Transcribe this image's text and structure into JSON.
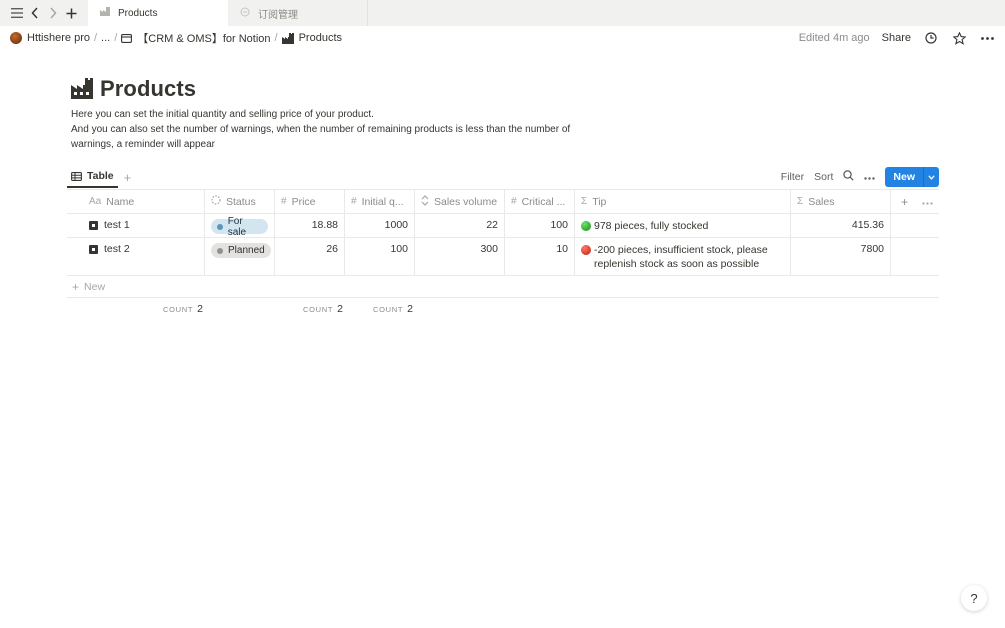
{
  "tabs": [
    {
      "label": "Products",
      "active": true
    },
    {
      "label": "订阅管理",
      "active": false
    }
  ],
  "breadcrumb": {
    "workspace": "Httishere pro",
    "ellipsis": "...",
    "parent": "【CRM & OMS】for Notion",
    "current": "Products",
    "separator": "/"
  },
  "header": {
    "edited": "Edited 4m ago",
    "share": "Share"
  },
  "page": {
    "title": "Products",
    "description": [
      "Here you can set the initial quantity and selling price of your product.",
      "And you can also set the number of warnings, when the number of remaining products is less than the number of warnings, a reminder will appear"
    ]
  },
  "view": {
    "tab_label": "Table",
    "filter": "Filter",
    "sort": "Sort",
    "new_label": "New"
  },
  "table": {
    "columns": [
      {
        "icon": "Aa",
        "label": "Name"
      },
      {
        "icon": "status-icon",
        "label": "Status"
      },
      {
        "icon": "#",
        "label": "Price"
      },
      {
        "icon": "#",
        "label": "Initial q..."
      },
      {
        "icon": "rollup-icon",
        "label": "Sales volume"
      },
      {
        "icon": "#",
        "label": "Critical ..."
      },
      {
        "icon": "Σ",
        "label": "Tip"
      },
      {
        "icon": "Σ",
        "label": "Sales"
      }
    ],
    "rows": [
      {
        "name": "test 1",
        "status": "For sale",
        "status_color": "#d3e5ef",
        "price": "18.88",
        "initial": "1000",
        "sales_volume": "22",
        "critical": "100",
        "tip_indicator": "green",
        "tip": "978 pieces, fully stocked",
        "sales": "415.36"
      },
      {
        "name": "test 2",
        "status": "Planned",
        "status_color": "#e3e2e0",
        "price": "26",
        "initial": "100",
        "sales_volume": "300",
        "critical": "10",
        "tip_indicator": "red",
        "tip": "-200 pieces, insufficient stock, please replenish stock as soon as possible",
        "sales": "7800"
      }
    ],
    "new_row_label": "New"
  },
  "footer": {
    "count_label": "COUNT",
    "name_count": "2",
    "price_count": "2",
    "initial_count": "2"
  },
  "help": "?",
  "colors": {
    "accent": "#2383e2",
    "text": "#37352f",
    "muted": "#8d8b87"
  }
}
